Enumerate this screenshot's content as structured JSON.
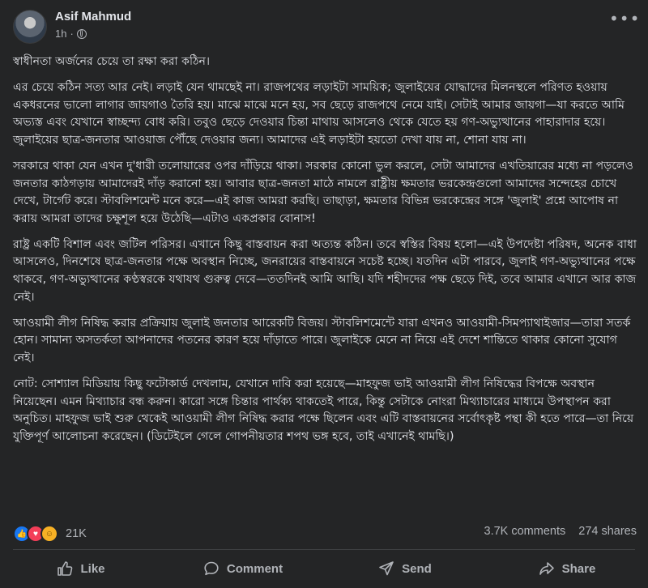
{
  "post": {
    "author": "Asif Mahmud",
    "time": "1h",
    "separator": "·",
    "paragraphs": [
      "স্বাধীনতা অর্জনের চেয়ে তা রক্ষা করা কঠিন।",
      "এর চেয়ে কঠিন সত্য আর নেই। লড়াই যেন থামছেই না। রাজপথের লড়াইটা সাময়িক; জুলাইয়ের যোদ্ধাদের মিলনস্থলে পরিণত হওয়ায় একধরনের ভালো লাগার জায়গাও তৈরি হয়। মাঝে মাঝে মনে হয়, সব ছেড়ে রাজপথে নেমে যাই। সেটাই আমার জায়গা—যা করতে আমি অভ্যস্ত এবং যেখানে স্বাচ্ছন্দ্য বোধ করি। তবুও ছেড়ে দেওয়ার চিন্তা মাথায় আসলেও থেকে যেতে হয় গণ-অভ্যুত্থানের পাহারাদার হয়ে। জুলাইয়ের ছাত্র-জনতার আওয়াজ পৌঁছে দেওয়ার জন্য। আমাদের এই লড়াইটা হয়তো দেখা যায় না, শোনা যায় না।",
      "সরকারে থাকা যেন এখন দু'ধারী তলোয়ারের ওপর দাঁড়িয়ে থাকা। সরকার কোনো ভুল করলে, সেটা আমাদের এখতিয়ারের মধ্যে না পড়লেও জনতার কাঠগড়ায় আমাদেরই দাঁড় করানো হয়। আবার ছাত্র-জনতা মাঠে নামলে রাষ্ট্রীয় ক্ষমতার ভরকেন্দ্রগুলো আমাদের সন্দেহের চোখে দেখে, টার্গেট করে। স্টাবলিশমেন্ট মনে করে—এই কাজ আমরা করছি। তাছাড়া, ক্ষমতার বিভিন্ন ভরকেন্দ্রের সঙ্গে 'জুলাই' প্রশ্নে আপোষ না করায় আমরা তাদের চক্ষুশূল হয়ে উঠেছি—এটাও একপ্রকার বোনাস!",
      "রাষ্ট্র একটি বিশাল এবং জটিল পরিসর। এখানে কিছু বাস্তবায়ন করা অত্যন্ত কঠিন। তবে স্বস্তির বিষয় হলো—এই উপদেষ্টা পরিষদ, অনেক বাধা আসলেও, দিনশেষে ছাত্র-জনতার পক্ষে অবস্থান নিচ্ছে, জনরায়ের বাস্তবায়নে সচেষ্ট হচ্ছে। যতদিন এটা পারবে, জুলাই গণ-অভ্যুত্থানের পক্ষে থাকবে, গণ-অভ্যুত্থানের কণ্ঠস্বরকে যথাযথ গুরুত্ব দেবে—ততদিনই আমি আছি। যদি শহীদদের পক্ষ ছেড়ে দিই, তবে আমার এখানে আর কাজ নেই।",
      "আওয়ামী লীগ নিষিদ্ধ করার প্রক্রিয়ায় জুলাই জনতার আরেকটি বিজয়। স্টাবলিশমেন্টে যারা এখনও আওয়ামী-সিমপ্যাথাইজার—তারা সতর্ক হোন। সামান্য অসতর্কতা আপনাদের পতনের কারণ হয়ে দাঁড়াতে পারে। জুলাইকে মেনে না নিয়ে এই দেশে শান্তিতে থাকার কোনো সুযোগ নেই।",
      "নোট: সোশ্যাল মিডিয়ায় কিছু ফটোকার্ড দেখলাম, যেখানে দাবি করা হয়েছে—মাহফুজ ভাই আওয়ামী লীগ নিষিদ্ধের বিপক্ষে অবস্থান নিয়েছেন। এমন মিথ্যাচার বন্ধ করুন। কারো সঙ্গে চিন্তার পার্থক্য থাকতেই পারে, কিন্তু সেটাকে নোংরা মিথ্যাচারের মাধ্যমে উপস্থাপন করা অনুচিত। মাহফুজ ভাই শুরু থেকেই আওয়ামী লীগ নিষিদ্ধ করার পক্ষে ছিলেন এবং এটি বাস্তবায়নের সর্বোৎকৃষ্ট পন্থা কী হতে পারে—তা নিয়ে যুক্তিপূর্ণ আলোচনা করেছেন। (ডিটেইলে গেলে গোপনীয়তার শপথ ভঙ্গ হবে, তাই এখানেই থামছি।)"
    ]
  },
  "stats": {
    "reactions_count": "21K",
    "comments": "3.7K comments",
    "shares": "274 shares"
  },
  "actions": {
    "like": "Like",
    "comment": "Comment",
    "send": "Send",
    "share": "Share"
  },
  "icons": {
    "more": "more-options-icon",
    "globe": "globe-icon",
    "like": "thumbs-up-icon",
    "comment": "comment-bubble-icon",
    "send": "send-icon",
    "share": "share-arrow-icon"
  },
  "colors": {
    "background": "#242526",
    "text": "#e4e6eb",
    "secondary": "#b0b3b8",
    "like_blue": "#1877f2",
    "love_red": "#f33e58",
    "care_yellow": "#f7b125"
  }
}
